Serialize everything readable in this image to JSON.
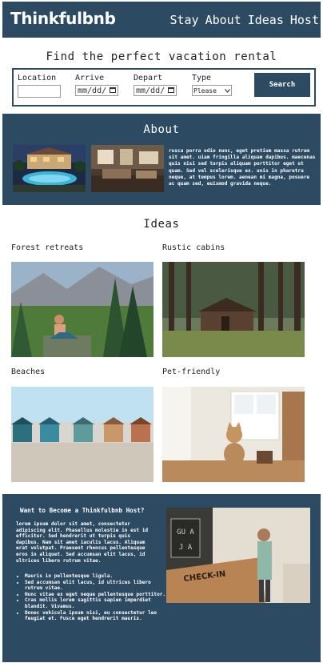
{
  "header": {
    "brand": "Thinkfulbnb",
    "nav": [
      "Stay",
      "About",
      "Ideas",
      "Host"
    ]
  },
  "finder": {
    "title": "Find the perfect vacation rental",
    "location_label": "Location",
    "location_value": "",
    "arrive_label": "Arrive",
    "arrive_value": "mm/dd/",
    "depart_label": "Depart",
    "depart_value": "mm/dd/",
    "type_label": "Type",
    "type_value": "Please",
    "search_label": "Search"
  },
  "about": {
    "title": "About",
    "text": "rusca porra odio nunc, eget pretium massa rutrum sit amet. uiam fringilla aliquam dapibus. maecenas quis nisi sed turpis aliquam porttitor eget ut quam. Sed vel scelerisque ex. unis in pharetra neque, at tempus lorem. aenean mi magna, posuere ac quam sed, euismod gravida neque."
  },
  "ideas": {
    "title": "Ideas",
    "items": [
      {
        "label": "Forest retreats"
      },
      {
        "label": "Rustic cabins"
      },
      {
        "label": "Beaches"
      },
      {
        "label": "Pet-friendly"
      }
    ]
  },
  "host": {
    "title": "Want to Become a Thinkfulbnb Host?",
    "body": "lorem ipsum dolor sit amet, consectetur adipiscing elit. Phasellus molestie in est id efficitur. Sed hendrerit ut turpis quis dapibus. Nam sit amet iaculis lacus. Aliquam erat volutpat. Praesent rhoncus pellentesque eros in aliquet. Sed accumsan elit lacus, id ultrices libero rutrum vitae.",
    "bullets": [
      "Mauris in pellentesque ligula.",
      "Sed accumsan elit lacus, id ultrices libero rutrum vitae.",
      "Nunc vitae ex eget neque pellentesque porttitor.",
      "Cras mollis lorem sagittis sapien imperdiet blandit. Vivamus.",
      "Donec vehicula ipsum nisi, eu consectetur leo feugiat et. Fusce eget hendrerit mauris."
    ],
    "sign_top": "GU A",
    "sign_bottom": "J A",
    "counter_text": "CHECK-IN"
  },
  "colors": {
    "primary": "#2c4a62",
    "background": "#ffffff"
  }
}
